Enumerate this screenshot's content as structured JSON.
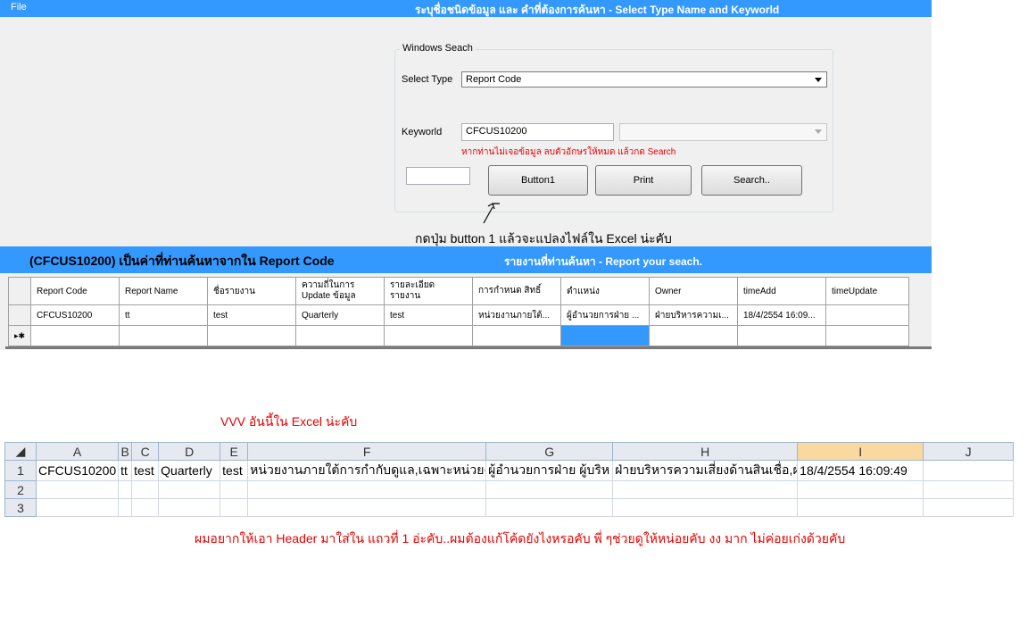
{
  "menu": {
    "file": "File"
  },
  "window_title": "ระบุชื่อชนิดข้อมูล และ คำที่ต้องการค้นหา - Select Type Name and Keyworld",
  "search_group": {
    "label": "Windows Seach",
    "select_type_label": "Select Type",
    "select_type_value": "Report Code",
    "keyword_label": "Keyworld",
    "keyword_value": "CFCUS10200",
    "keyword_hint": "หากท่านไม่เจอข้อมูล ลบตัวอักษรให้หมด แล้วกด Search",
    "small_input_value": "",
    "buttons": {
      "button1": "Button1",
      "print": "Print",
      "search": "Search.."
    }
  },
  "annotation_note": "กดปุ่ม  button 1 แล้วจะแปลงไฟล์ใน  Excel  น่ะคับ",
  "result_bar": {
    "left": "(CFCUS10200)  เป็นค่าที่ท่านค้นหาจากใน  Report Code",
    "right": "รายงานที่ท่านค้นหา - Report your seach."
  },
  "grid": {
    "columns": [
      "Report Code",
      "Report Name",
      "ชื่อรายงาน",
      "ความถี่ในการ Update ข้อมูล",
      "รายละเอียด รายงาน",
      "การกำหนด สิทธิ์",
      "ตำแหน่ง",
      "Owner",
      "timeAdd",
      "timeUpdate"
    ],
    "rows": [
      [
        "CFCUS10200",
        "tt",
        "test",
        "Quarterly",
        "test",
        "หน่วยงานภายใต้...",
        "ผู้อำนวยการฝ่าย ...",
        "ฝ่ายบริหารความเ...",
        "18/4/2554 16:09...",
        ""
      ]
    ],
    "new_row_marker": "▸✱"
  },
  "excel_note": "VVV อันนี้ใน   Excel น่ะคับ",
  "excel": {
    "col_headers": [
      "A",
      "B",
      "C",
      "D",
      "E",
      "F",
      "G",
      "H",
      "I",
      "J"
    ],
    "row_numbers": [
      "1",
      "2",
      "3"
    ],
    "row1": [
      "CFCUS10200",
      "tt",
      "test",
      "Quarterly",
      "test",
      "หน่วยงานภายใต้การกำกับดูแล,เฉพาะหน่วยง",
      "ผู้อำนวยการฝ่าย ผู้บริห",
      "ฝ่ายบริหารความเสี่ยงด้านสินเชื่อ,ฝ่",
      "18/4/2554 16:09:49",
      ""
    ]
  },
  "bottom_note": "ผมอยากให้เอา   Header มาใส่ใน   แถวที่   1 อ่ะคับ..ผมต้องแก้โค้ดยังไงหรอคับ   พี่  ๆช่วยดูให้หน่อยคับ   งง  มาก   ไม่ค่อยเก่งด้วยคับ",
  "colors": {
    "accent": "#3399ff",
    "hint_red": "#e60000",
    "excel_selected_header": "#f9d99f"
  }
}
